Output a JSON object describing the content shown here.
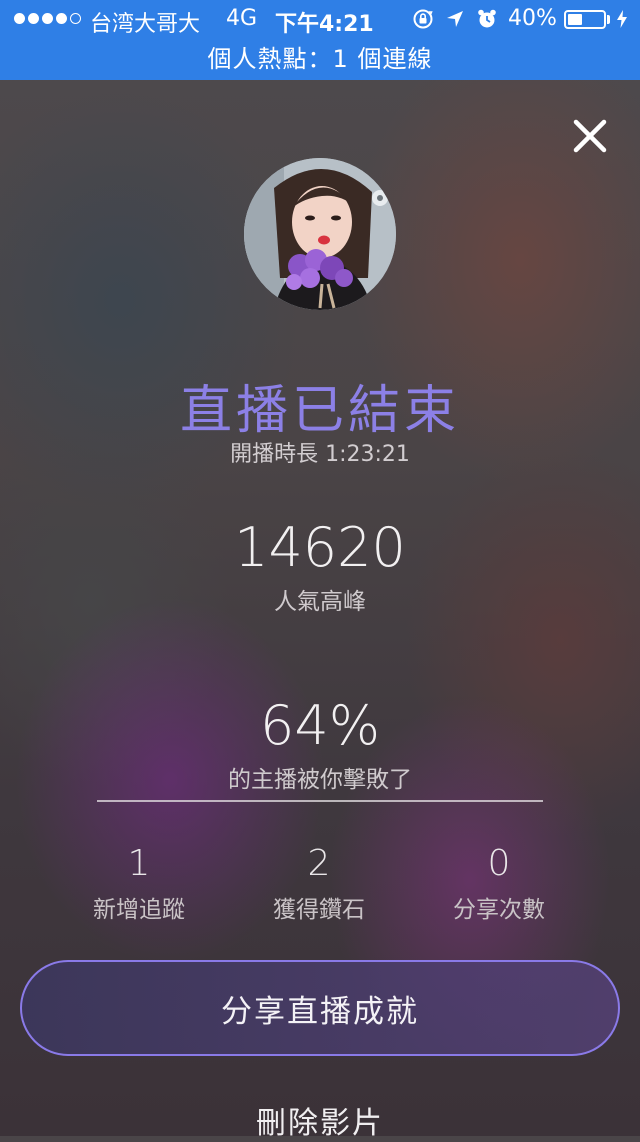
{
  "status_bar": {
    "carrier": "台湾大哥大",
    "network": "4G",
    "time": "下午4:21",
    "battery_percent_text": "40%",
    "battery_level": 0.4,
    "icons": [
      "orientation-lock-icon",
      "location-arrow-icon",
      "alarm-icon",
      "charging-bolt-icon"
    ]
  },
  "hotspot": {
    "text": "個人熱點：1 個連線"
  },
  "close": {
    "icon": "close-icon"
  },
  "live_end": {
    "title": "直播已結束",
    "duration": "開播時長 1:23:21",
    "peak_value": "14620",
    "peak_label": "人氣高峰",
    "percent_value": "64%",
    "percent_label": "的主播被你擊敗了"
  },
  "stats": [
    {
      "value": "1",
      "label": "新增追蹤"
    },
    {
      "value": "2",
      "label": "獲得鑽石"
    },
    {
      "value": "0",
      "label": "分享次數"
    }
  ],
  "actions": {
    "share_label": "分享直播成就",
    "delete_label": "刪除影片"
  },
  "colors": {
    "status_bar_bg": "#2f7fe6",
    "title_accent": "#8c80e6",
    "button_border": "#8a7ae8"
  }
}
